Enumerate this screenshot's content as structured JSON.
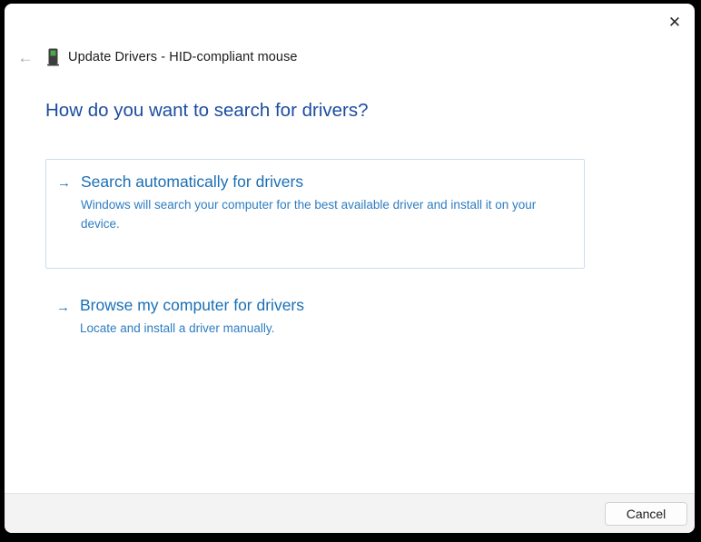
{
  "window": {
    "title": "Update Drivers - HID-compliant mouse",
    "icons": {
      "close": "✕",
      "back": "←",
      "option_arrow": "→"
    }
  },
  "main": {
    "heading": "How do you want to search for drivers?",
    "options": [
      {
        "title": "Search automatically for drivers",
        "description": "Windows will search your computer for the best available driver and install it on your device."
      },
      {
        "title": "Browse my computer for drivers",
        "description": "Locate and install a driver manually."
      }
    ]
  },
  "footer": {
    "cancel_label": "Cancel"
  },
  "colors": {
    "heading_blue": "#1c4da0",
    "option_title_blue": "#1a6fb5",
    "option_desc_blue": "#2e7dc1",
    "card_border": "#cddcea",
    "footer_bg": "#f3f3f3",
    "window_frame": "#000000"
  }
}
